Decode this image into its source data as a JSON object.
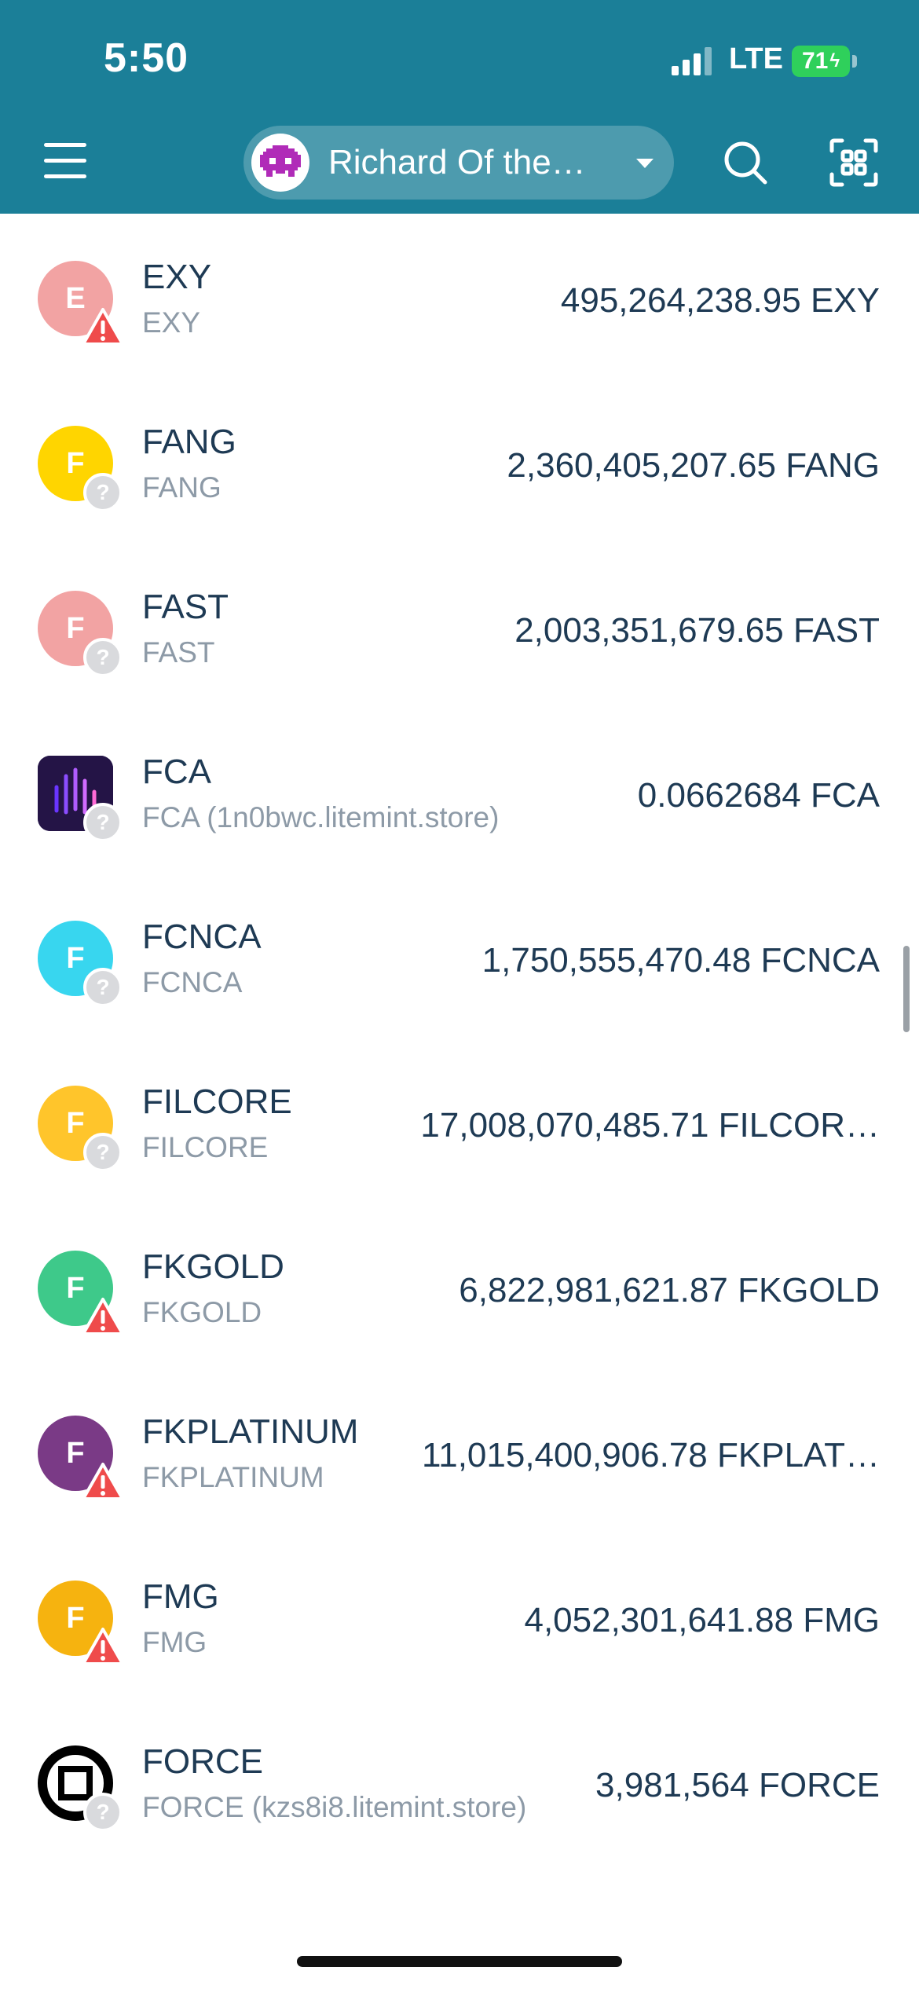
{
  "status_bar": {
    "time": "5:50",
    "network": "LTE",
    "battery": "71"
  },
  "header": {
    "account_name": "Richard Of the…",
    "icons": [
      "menu-icon",
      "avatar-icon",
      "chevron-down-icon",
      "search-icon",
      "qr-scan-icon"
    ],
    "colors": {
      "background": "#1b7f98"
    }
  },
  "assets": [
    {
      "code": "EXY",
      "subtitle": "EXY",
      "balance": "495,264,238.95 EXY",
      "letter": "E",
      "color": "#f2a3a3",
      "badge": "warning"
    },
    {
      "code": "FANG",
      "subtitle": "FANG",
      "balance": "2,360,405,207.65 FANG",
      "letter": "F",
      "color": "#ffd500",
      "badge": "unknown"
    },
    {
      "code": "FAST",
      "subtitle": "FAST",
      "balance": "2,003,351,679.65 FAST",
      "letter": "F",
      "color": "#f2a3a3",
      "badge": "unknown"
    },
    {
      "code": "FCA",
      "subtitle": "FCA (1n0bwc.litemint.store)",
      "balance": "0.0662684 FCA",
      "letter": "",
      "color": "#2a1a5e",
      "badge": "unknown"
    },
    {
      "code": "FCNCA",
      "subtitle": "FCNCA",
      "balance": "1,750,555,470.48 FCNCA",
      "letter": "F",
      "color": "#38d6ef",
      "badge": "unknown"
    },
    {
      "code": "FILCORE",
      "subtitle": "FILCORE",
      "balance": "17,008,070,485.71 FILCOR…",
      "letter": "F",
      "color": "#ffc52b",
      "badge": "unknown"
    },
    {
      "code": "FKGOLD",
      "subtitle": "FKGOLD",
      "balance": "6,822,981,621.87 FKGOLD",
      "letter": "F",
      "color": "#3ec98a",
      "badge": "warning"
    },
    {
      "code": "FKPLATINUM",
      "subtitle": "FKPLATINUM",
      "balance": "11,015,400,906.78 FKPLAT…",
      "letter": "F",
      "color": "#7a3a86",
      "badge": "warning"
    },
    {
      "code": "FMG",
      "subtitle": "FMG",
      "balance": "4,052,301,641.88 FMG",
      "letter": "F",
      "color": "#f6b30f",
      "badge": "warning"
    },
    {
      "code": "FORCE",
      "subtitle": "FORCE (kzs8i8.litemint.store)",
      "balance": "3,981,564 FORCE",
      "letter": "",
      "color": "#000000",
      "badge": "unknown"
    }
  ]
}
